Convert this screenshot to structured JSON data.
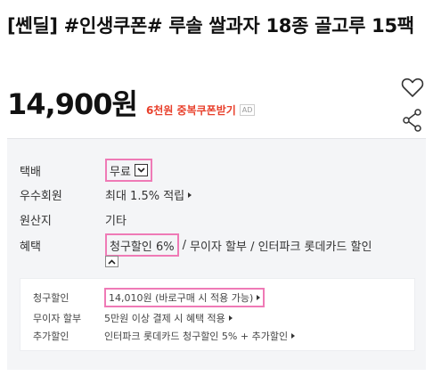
{
  "product": {
    "title": "[쎈딜] #인생쿠폰# 루솔 쌀과자 18종 골고루 15팩",
    "price": "14,900원",
    "coupon_text": "6천원 중복쿠폰받기",
    "ad_badge": "AD"
  },
  "details": {
    "shipping": {
      "label": "택배",
      "value": "무료"
    },
    "membership": {
      "label": "우수회원",
      "value": "최대 1.5% 적립"
    },
    "origin": {
      "label": "원산지",
      "value": "기타"
    },
    "benefits": {
      "label": "혜택",
      "highlight": "청구할인 6%",
      "separator": "/",
      "rest": "무이자 할부 / 인터파크 롯데카드 할인"
    }
  },
  "benefit_detail": {
    "billing_discount": {
      "label": "청구할인",
      "value": "14,010원 (바로구매 시 적용 가능)"
    },
    "installment": {
      "label": "무이자 할부",
      "value": "5만원 이상 결제 시 혜택 적용"
    },
    "extra_discount": {
      "label": "추가할인",
      "value": "인터파크 롯데카드 청구할인 5% + 추가할인"
    }
  },
  "colors": {
    "highlight_border": "#ef7ab6",
    "coupon_red": "#e8402c",
    "panel_bg": "#f4f5f7"
  },
  "icons": {
    "wishlist": "heart-outline-icon",
    "share": "share-icon",
    "dropdown": "chevron-down-icon",
    "collapse": "chevron-up-icon",
    "more": "triangle-right-icon"
  }
}
